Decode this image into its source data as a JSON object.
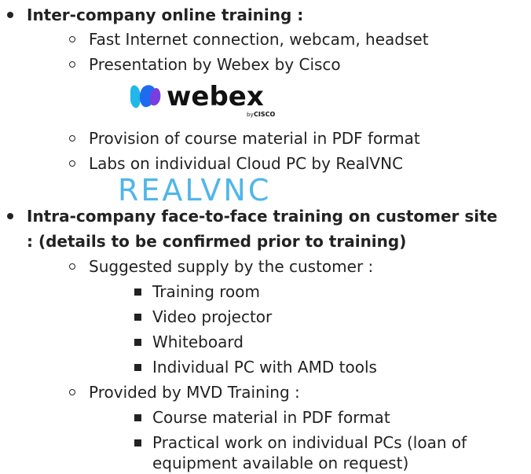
{
  "sections": [
    {
      "title": "Inter-company online training :",
      "items": [
        "Fast Internet connection, webcam, headset",
        "Presentation by Webex by Cisco",
        "Provision of course material in PDF format",
        "Labs on individual Cloud PC by RealVNC"
      ],
      "logos": {
        "webex": {
          "word": "webex",
          "by": "by",
          "cisco": "CISCO",
          "colors": [
            "#1fb8e8",
            "#1d6cf0",
            "#7a3ee0"
          ]
        },
        "realvnc": {
          "word": "REALVNC",
          "color": "#4fb6ea"
        }
      }
    },
    {
      "title_line1": "Intra-company face-to-face training on customer site",
      "title_line2": ": (details to be confirmed prior to training)",
      "groups": [
        {
          "label": "Suggested supply by the customer :",
          "items": [
            "Training room",
            "Video projector",
            "Whiteboard",
            "Individual PC with AMD tools"
          ]
        },
        {
          "label": "Provided by MVD Training :",
          "items": [
            "Course material in PDF format",
            "Practical work on individual PCs (loan of",
            "equipment available on request)"
          ]
        }
      ]
    }
  ]
}
